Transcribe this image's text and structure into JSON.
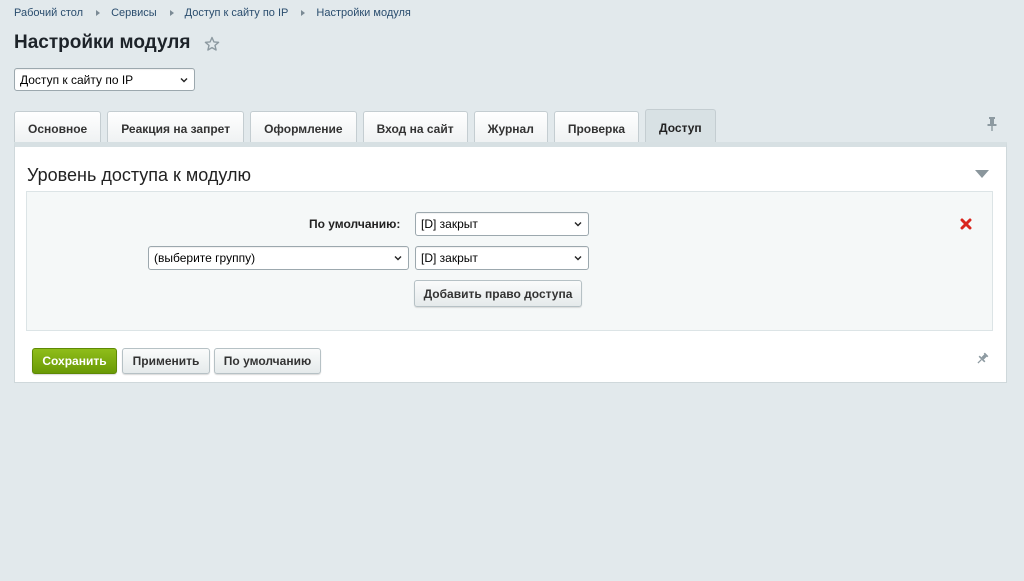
{
  "breadcrumb": [
    "Рабочий стол",
    "Сервисы",
    "Доступ к сайту по IP",
    "Настройки модуля"
  ],
  "page": {
    "title": "Настройки модуля"
  },
  "module_select": {
    "value": "Доступ к сайту по IP"
  },
  "tabs": [
    {
      "label": "Основное"
    },
    {
      "label": "Реакция на запрет"
    },
    {
      "label": "Оформление"
    },
    {
      "label": "Вход на сайт"
    },
    {
      "label": "Журнал"
    },
    {
      "label": "Проверка"
    },
    {
      "label": "Доступ",
      "active": true
    }
  ],
  "section": {
    "title": "Уровень доступа к модулю",
    "default_label": "По умолчанию:",
    "default_value": "[D] закрыт",
    "group_select": "(выберите группу)",
    "group_access_value": "[D] закрыт",
    "add_button": "Добавить право доступа"
  },
  "footer": {
    "save": "Сохранить",
    "apply": "Применить",
    "defaults": "По умолчанию"
  },
  "colors": {
    "background": "#e2e9ec",
    "save_button": "#7aa80e",
    "delete_icon": "#d9251c",
    "link": "#2a4d6e"
  },
  "icons": [
    "star-icon",
    "chevron-down-icon",
    "pin-icon",
    "delete-icon",
    "collapse-arrow-icon",
    "breadcrumb-arrow-icon"
  ]
}
